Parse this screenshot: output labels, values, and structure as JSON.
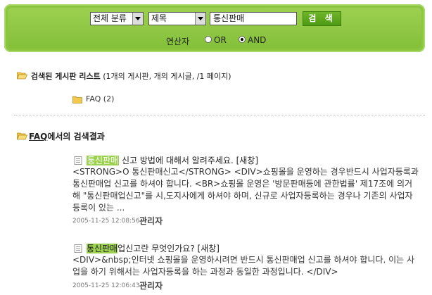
{
  "search": {
    "category_value": "전체 분류",
    "field_value": "제목",
    "keyword": "통신판매",
    "button_label": "검 색",
    "operator_label": "연산자",
    "or_label": "OR",
    "and_label": "AND",
    "selected_operator": "AND"
  },
  "board_list": {
    "title": "검색된 게시판 리스트",
    "summary": "(1개의 게시판, 개의 게시글, /1 페이지)",
    "items": [
      {
        "label": "FAQ (2)"
      }
    ]
  },
  "results_section": {
    "board_name": "FAQ",
    "heading_suffix": "에서의 검색결과"
  },
  "results": [
    {
      "title_highlight": "통신판매",
      "title_rest": " 신고 방법에 대해서 알려주세요. [새창]",
      "body": "<STRONG>O 통신판매신고</STRONG> <DIV>쇼핑몰을 운영하는 경우반드시 사업자등록과 통신판매업 신고를 하셔야 합니다. <BR>쇼핑몰 운영은 '방문판매등에 관한법률' 제17조에 의거해 \"통신판매업신고\"를 시,도지사에게 하셔야 하며, 신규로 사업자등록하는 경우나 기존의 사업자등록이 있는 ...",
      "date": "2005-11-25 12:08:56",
      "author": "관리자"
    },
    {
      "title_highlight": "통신판매",
      "title_rest": "업신고란 무엇인가요? [새창]",
      "body": "<DIV>&nbsp;인터넷 쇼핑몰을 운영하시려면 반드시 통신판매업 신고를 하셔야 합니다. 이는 사업을 하기 위해서는 사업자등록을 하는 과정과 동일한 과정입니다. </DIV>",
      "date": "2005-11-25 12:06:43",
      "author": "관리자"
    }
  ],
  "colors": {
    "accent": "#8cc63f",
    "highlight": "#9bd14d",
    "folder": "#f2c94c"
  }
}
